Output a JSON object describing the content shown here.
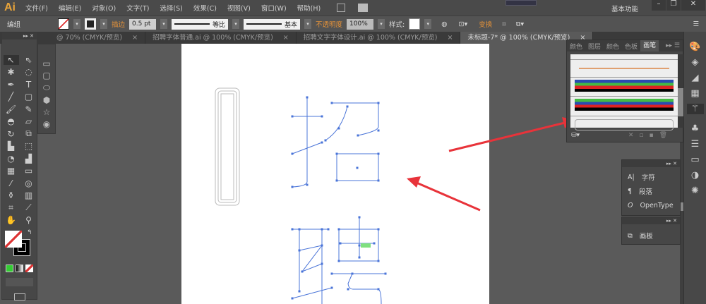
{
  "app": {
    "logo": "Ai",
    "workspace": "基本功能"
  },
  "menu": [
    "文件(F)",
    "编辑(E)",
    "对象(O)",
    "文字(T)",
    "选择(S)",
    "效果(C)",
    "视图(V)",
    "窗口(W)",
    "帮助(H)"
  ],
  "control": {
    "selection": "编组",
    "stroke_label": "描边",
    "stroke_weight": "0.5 pt",
    "profile": "等比",
    "brush": "基本",
    "opacity_label": "不透明度",
    "opacity": "100%",
    "style_label": "样式:",
    "transform": "变换"
  },
  "tabs": [
    {
      "label": "@ 70% (CMYK/预览)"
    },
    {
      "label": "招聘字体普通.ai @ 100% (CMYK/预览)"
    },
    {
      "label": "招聘文字字体设计.ai @ 100% (CMYK/预览)"
    },
    {
      "label": "未标题-7* @ 100% (CMYK/预览)",
      "active": true
    }
  ],
  "close_glyph": "×",
  "brush_panel": {
    "tabs": [
      "颜色",
      "图层",
      "颜色",
      "色板",
      "画笔"
    ],
    "active": "画笔"
  },
  "char_panel": {
    "items": [
      "字符",
      "段落",
      "OpenType"
    ]
  },
  "artboard_panel": {
    "items": [
      "画板"
    ]
  },
  "colors": {
    "accent": "#e0903a",
    "path": "#4a74d8",
    "arrow": "#e8333a"
  }
}
